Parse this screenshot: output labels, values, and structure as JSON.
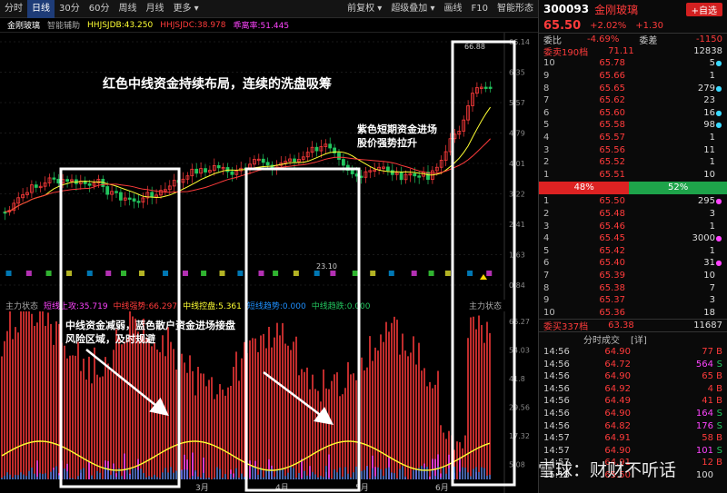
{
  "toolbar": {
    "items": [
      "分时",
      "日线",
      "30分",
      "60分",
      "周线",
      "月线",
      "更多 ▾",
      "前复权 ▾",
      "超级叠加 ▾",
      "画线",
      "F10",
      "智能形态"
    ],
    "active": 1
  },
  "info": {
    "stock_name": "金刚玻璃",
    "assist": "智能辅助",
    "hhjsjdb": "HHJSJDB:43.250",
    "hhjsjdc": "HHJSJDC:38.978",
    "gap": "乖离率:51.445"
  },
  "price_axis": [
    "66.14",
    "6.35",
    "5.57",
    "4.79",
    "4.01",
    "3.22",
    "2.41",
    "1.63",
    "0.84"
  ],
  "chart_labels": {
    "high": "66.88",
    "low": "23.10"
  },
  "indicator": {
    "title": "主力状态",
    "l1": "短线上攻:35.719",
    "l2": "中线强势:66.297",
    "l3": "中线控盘:5.361",
    "l4": "短线趋势:0.000",
    "l5": "中线趋跌:0.000",
    "right_title": "主力状态"
  },
  "lower_axis": [
    "66.27",
    "54.03",
    "41.8",
    "29.56",
    "17.32",
    "5.08"
  ],
  "months": [
    "3月",
    "4月",
    "5月",
    "6月"
  ],
  "annotations": {
    "a1": "红色中线资金持续布局，连续的洗盘吸筹",
    "a2": "紫色短期资金进场\n股价强势拉升",
    "a3": "中线资金减弱，蓝色散户资金进场接盘\n风险区域，及时规避"
  },
  "side": {
    "code": "300093",
    "name": "金刚玻璃",
    "add": "+自选",
    "price": "65.50",
    "pct": "+2.02%",
    "chg": "+1.30",
    "wb_label": "委比",
    "wb": "-4.69%",
    "wc_label": "委差",
    "wc": "-1150",
    "sell_label": "委卖190档",
    "sell_price": "71.11",
    "sell_vol": "12838",
    "asks": [
      [
        "10",
        "65.78",
        "5"
      ],
      [
        "9",
        "65.66",
        "1"
      ],
      [
        "8",
        "65.65",
        "279"
      ],
      [
        "7",
        "65.62",
        "23"
      ],
      [
        "6",
        "65.60",
        "16"
      ],
      [
        "5",
        "65.58",
        "98"
      ],
      [
        "4",
        "65.57",
        "1"
      ],
      [
        "3",
        "65.56",
        "11"
      ],
      [
        "2",
        "65.52",
        "1"
      ],
      [
        "1",
        "65.51",
        "10"
      ]
    ],
    "ratio_l": "48%",
    "ratio_r": "52%",
    "bids": [
      [
        "1",
        "65.50",
        "295"
      ],
      [
        "2",
        "65.48",
        "3"
      ],
      [
        "3",
        "65.46",
        "1"
      ],
      [
        "4",
        "65.45",
        "3000"
      ],
      [
        "5",
        "65.42",
        "1"
      ],
      [
        "6",
        "65.40",
        "31"
      ],
      [
        "7",
        "65.39",
        "10"
      ],
      [
        "8",
        "65.38",
        "7"
      ],
      [
        "9",
        "65.37",
        "3"
      ],
      [
        "10",
        "65.36",
        "18"
      ]
    ],
    "buy_label": "委买337档",
    "buy_price": "63.38",
    "buy_vol": "11687",
    "ticks_label": "分时成交",
    "ticks_flag": "[详]",
    "ticks": [
      [
        "14:56",
        "64.90",
        "77",
        "B"
      ],
      [
        "14:56",
        "64.72",
        "564",
        "S"
      ],
      [
        "14:56",
        "64.90",
        "65",
        "B"
      ],
      [
        "14:56",
        "64.92",
        "4",
        "B"
      ],
      [
        "14:56",
        "64.49",
        "41",
        "B"
      ],
      [
        "14:56",
        "64.90",
        "164",
        "S"
      ],
      [
        "14:56",
        "64.82",
        "176",
        "S"
      ],
      [
        "14:57",
        "64.91",
        "58",
        "B"
      ],
      [
        "14:57",
        "64.90",
        "101",
        "S"
      ],
      [
        "14:57",
        "64.91",
        "12",
        "B"
      ],
      [
        "15:18",
        "65.50",
        "100",
        ""
      ]
    ]
  },
  "watermark": "雪球：财财不听话",
  "colors": {
    "up": "#ff3b3b",
    "down": "#22c55e",
    "ma_yellow": "#ffff33",
    "purple": "#ff44ff",
    "blue": "#1e90ff"
  }
}
